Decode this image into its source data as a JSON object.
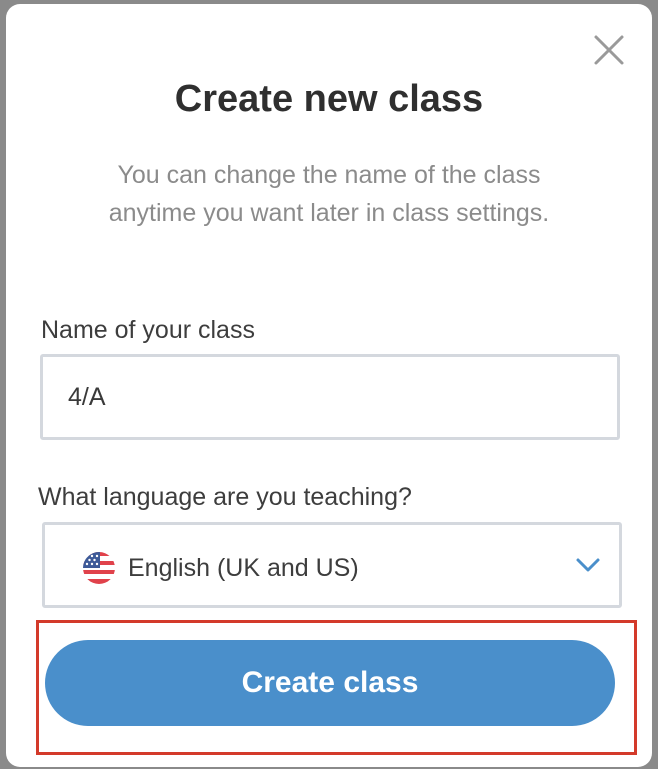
{
  "dialog": {
    "title": "Create new class",
    "subtitle": "You can change the name of the class anytime you want later in class settings.",
    "close_icon": "close-icon"
  },
  "class_name": {
    "label": "Name of your class",
    "value": "4/A"
  },
  "language": {
    "label": "What language are you teaching?",
    "selected": "English (UK and US)",
    "flag_icon": "us-flag-icon",
    "dropdown_icon": "chevron-down-icon"
  },
  "actions": {
    "create_label": "Create class"
  },
  "colors": {
    "primary": "#4a8fcb",
    "highlight": "#d33a2a",
    "title_text": "#2f2f2f",
    "muted_text": "#8b8b8b",
    "border": "#d4d8de"
  }
}
